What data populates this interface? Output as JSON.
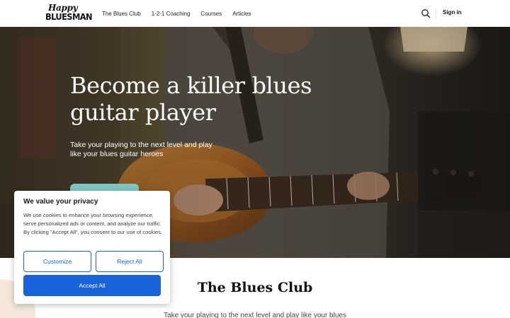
{
  "header": {
    "logo_top": "Happy",
    "logo_bottom": "BLUESMAN",
    "nav": [
      "The Blues Club",
      "1-2-1 Coaching",
      "Courses",
      "Articles"
    ],
    "search_icon": "search-icon",
    "signin_label": "Sign in"
  },
  "hero": {
    "title": "Become a killer blues guitar player",
    "subtitle": "Take your playing to the next level and play like your blues guitar heroes",
    "cta_color": "#7ec7c4"
  },
  "section": {
    "title": "The Blues Club",
    "subtitle": "Take your playing to the next level and play like your blues"
  },
  "cookie": {
    "title": "We value your privacy",
    "text": "We use cookies to enhance your browsing experience, serve personalized ads or content, and analyze our traffic. By clicking \"Accept All\", you consent to our use of cookies.",
    "customize_label": "Customize",
    "reject_label": "Reject All",
    "accept_label": "Accept All",
    "accent_color": "#1863dc"
  }
}
